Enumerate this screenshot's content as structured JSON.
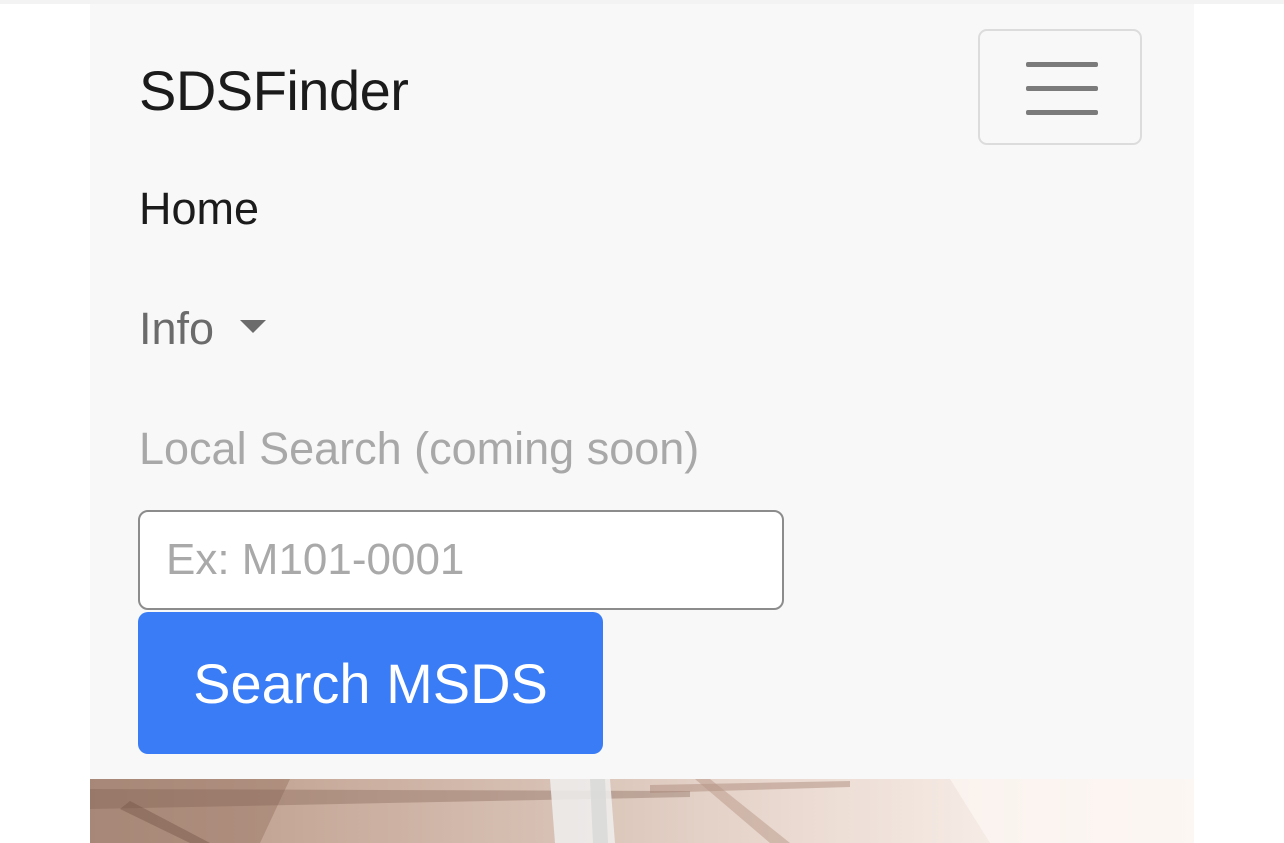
{
  "navbar": {
    "brand": "SDSFinder",
    "toggler_icon": "hamburger-menu-icon",
    "links": {
      "home": "Home",
      "info": "Info"
    },
    "info_dropdown_icon": "caret-down-icon",
    "local_search_label": "Local Search (coming soon)",
    "search": {
      "placeholder": "Ex: M101-0001",
      "value": "",
      "button_label": "Search MSDS"
    }
  },
  "colors": {
    "navbar_bg": "#f8f8f8",
    "brand_text": "#1b1b1b",
    "muted_text": "#6b6b6b",
    "disabled_text": "#a8a8a8",
    "primary_button": "#3a7cf6"
  }
}
